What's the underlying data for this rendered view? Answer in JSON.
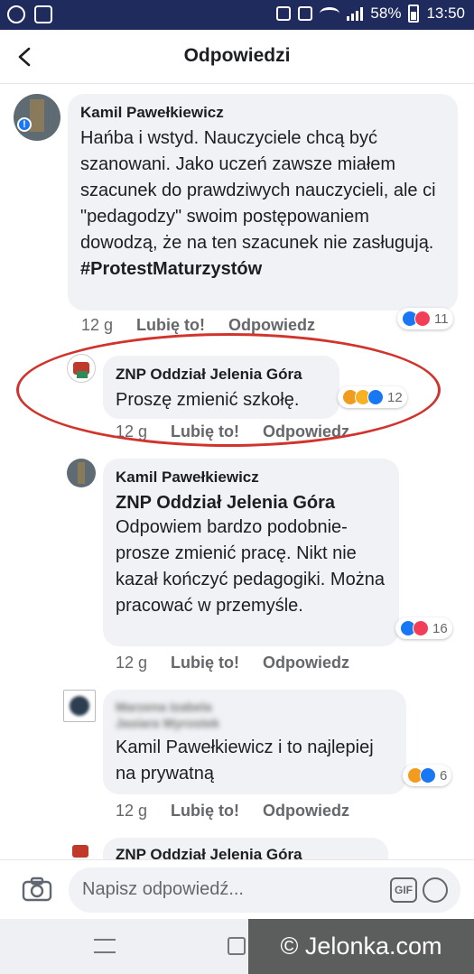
{
  "status_bar": {
    "battery": "58%",
    "time": "13:50"
  },
  "header": {
    "title": "Odpowiedzi"
  },
  "comments": [
    {
      "author": "Kamil Pawełkiewicz",
      "text": "Hańba i wstyd. Nauczyciele chcą być szanowani. Jako uczeń zawsze miałem szacunek do prawdziwych nauczycieli, ale ci \"pedagodzy\" swoim postępowaniem dowodzą, że na ten szacunek nie zasługują.",
      "hashtag": "#ProtestMaturzystów",
      "time": "12 g",
      "like": "Lubię to!",
      "reply": "Odpowiedz",
      "reaction_count": "11"
    },
    {
      "author": "ZNP Oddział Jelenia Góra",
      "text": "Proszę zmienić szkołę.",
      "time": "12 g",
      "like": "Lubię to!",
      "reply": "Odpowiedz",
      "reaction_count": "12"
    },
    {
      "author": "Kamil Pawełkiewicz",
      "tagged": "ZNP Oddział Jelenia Góra",
      "text": "Odpowiem bardzo podobnie- prosze zmienić pracę.  Nikt nie kazał kończyć pedagogiki. Można pracować w przemyśle.",
      "time": "12 g",
      "like": "Lubię to!",
      "reply": "Odpowiedz",
      "reaction_count": "16"
    },
    {
      "author_blurred_line1": "Marzena Izabela",
      "author_blurred_line2": "Jasiara Wyrostek",
      "text": "Kamil Pawełkiewicz i to najlepiej na prywatną",
      "time": "12 g",
      "like": "Lubię to!",
      "reply": "Odpowiedz",
      "reaction_count": "6"
    },
    {
      "author": "ZNP Oddział Jelenia Góra"
    }
  ],
  "composer": {
    "placeholder": "Napisz odpowiedź...",
    "gif_label": "GIF"
  },
  "watermark": "© Jelonka.com",
  "colors": {
    "status_bar": "#1f2b5c",
    "bubble": "#f0f2f5",
    "highlight_ring": "#d0342c",
    "like": "#1877f2",
    "love": "#f33e58"
  }
}
